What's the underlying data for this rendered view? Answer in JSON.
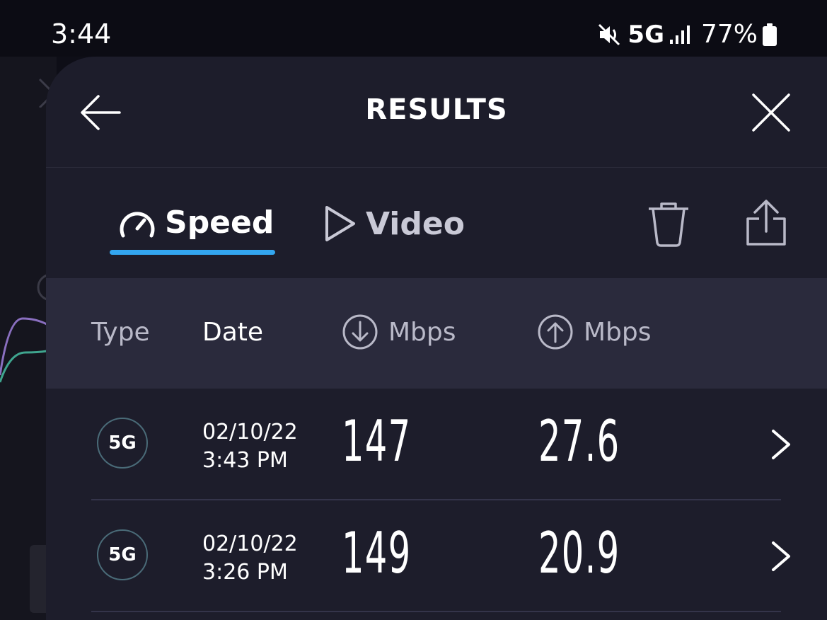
{
  "status_bar": {
    "time": "3:44",
    "network": "5G",
    "battery": "77%"
  },
  "header": {
    "title": "RESULTS",
    "back_icon": "arrow-left-icon",
    "close_icon": "close-icon"
  },
  "tabs": [
    {
      "label": "Speed",
      "icon": "speedometer-icon",
      "active": true
    },
    {
      "label": "Video",
      "icon": "play-icon",
      "active": false
    }
  ],
  "actions": {
    "delete_icon": "trash-icon",
    "share_icon": "share-icon"
  },
  "columns": {
    "type": "Type",
    "date": "Date",
    "download": "Mbps",
    "upload": "Mbps"
  },
  "results": [
    {
      "type": "5G",
      "date": "02/10/22",
      "time": "3:43 PM",
      "download": "147",
      "upload": "27.6"
    },
    {
      "type": "5G",
      "date": "02/10/22",
      "time": "3:26 PM",
      "download": "149",
      "upload": "20.9"
    }
  ],
  "colors": {
    "accent": "#33a6f0",
    "sheet_bg": "#1d1d2b",
    "header_row_bg": "#2a2a3c",
    "badge_border": "#4a6b78"
  }
}
